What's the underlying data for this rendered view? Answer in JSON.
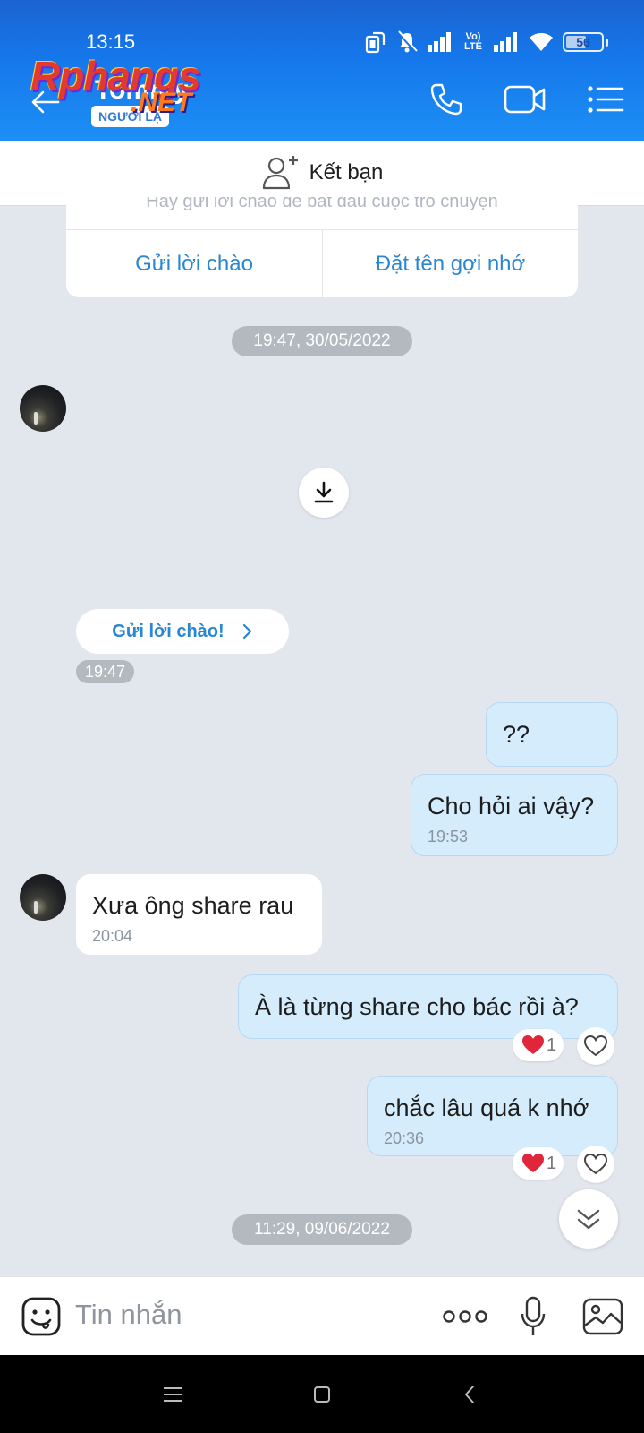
{
  "status_bar": {
    "time": "13:15",
    "volte_label": "Vo) LTE",
    "battery_level": "56",
    "icons": [
      "screen-rotate-icon",
      "mute-bell-icon",
      "signal-icon",
      "volte-icon",
      "signal-icon",
      "wifi-icon",
      "battery-icon"
    ]
  },
  "header": {
    "contact_name": "Tommy",
    "badge": "NGƯỜI LẠ",
    "watermark_main": "Rphangs",
    "watermark_sub": ".NET",
    "actions": [
      "call-icon",
      "video-call-icon",
      "menu-icon"
    ]
  },
  "add_friend": {
    "label": "Kết bạn"
  },
  "greeting_card": {
    "hint": "Hãy gửi lời chào để bắt đầu cuộc trò chuyện",
    "left_button": "Gửi lời chào",
    "right_button": "Đặt tên gợi nhớ"
  },
  "date_separators": [
    "19:47, 30/05/2022",
    "11:29, 09/06/2022"
  ],
  "hello_chip": {
    "label": "Gửi lời chào!",
    "time": "19:47"
  },
  "messages": [
    {
      "direction": "out",
      "text": "??",
      "time": ""
    },
    {
      "direction": "out",
      "text": "Cho hỏi ai vậy?",
      "time": "19:53"
    },
    {
      "direction": "in",
      "text": "Xưa ông share rau",
      "time": "20:04"
    },
    {
      "direction": "out",
      "text": "À là từng share cho bác rồi à?",
      "time": "",
      "reaction_count": "1"
    },
    {
      "direction": "out",
      "text": "chắc lâu quá k nhớ",
      "time": "20:36",
      "reaction_count": "1"
    }
  ],
  "composer": {
    "placeholder": "Tin nhắn"
  },
  "colors": {
    "header_blue": "#1577ea",
    "link_blue": "#2a86d2",
    "outgoing_bubble": "#d5ecfd",
    "chat_background": "#e2e7ee",
    "reaction_heart": "#e0263a"
  }
}
